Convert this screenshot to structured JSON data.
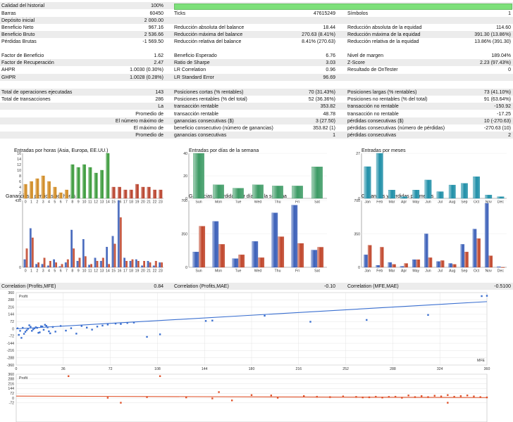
{
  "header": {
    "calidad_label": "Calidad del historial",
    "calidad_value": "100%",
    "calidad_fill": 1.0
  },
  "stats_top": [
    {
      "l1": "Barras",
      "v1": "60450",
      "l2": "Ticks",
      "v2": "47615249",
      "l3": "Símbolos",
      "v3": "1"
    },
    {
      "l1": "Depósito inicial",
      "v1": "2 000.00",
      "l2": "",
      "v2": "",
      "l3": "",
      "v3": ""
    },
    {
      "l1": "Beneficio Neto",
      "v1": "967.16",
      "l2": "Reducción absoluta del balance",
      "v2": "18.44",
      "l3": "Reducción absoluta de la equidad",
      "v3": "114.60"
    },
    {
      "l1": "Beneficio Bruto",
      "v1": "2 536.66",
      "l2": "Reducción máxima del balance",
      "v2": "270.63 (8.41%)",
      "l3": "Reducción máxima de la equidad",
      "v3": "391.30 (13.86%)"
    },
    {
      "l1": "Pérdidas Brutas",
      "v1": "-1 569.50",
      "l2": "Reducción relativa del balance",
      "v2": "8.41% (270.63)",
      "l3": "Reducción relativa de la equidad",
      "v3": "13.86% (391.30)"
    }
  ],
  "stats_mid": [
    {
      "l1": "Factor de Beneficio",
      "v1": "1.62",
      "l2": "Beneficio Esperado",
      "v2": "6.76",
      "l3": "Nivel de margen",
      "v3": "189.04%"
    },
    {
      "l1": "Factor de Recuperación",
      "v1": "2.47",
      "l2": "Ratio de Sharpe",
      "v2": "3.03",
      "l3": "Z-Score",
      "v3": "2.23 (97.43%)"
    },
    {
      "l1": "AHPR",
      "v1": "1.0030 (0.30%)",
      "l2": "LR Correlation",
      "v2": "0.96",
      "l3": "Resultado de OnTester",
      "v3": "0"
    },
    {
      "l1": "GHPR",
      "v1": "1.0028 (0.28%)",
      "l2": "LR Standard Error",
      "v2": "96.69",
      "l3": "",
      "v3": ""
    }
  ],
  "stats_trades": [
    {
      "l1": "Total de operaciones ejecutadas",
      "v1": "143",
      "l2": "Posiciones cortas (% rentables)",
      "v2": "70 (31.43%)",
      "l3": "Posiciones largas (% rentables)",
      "v3": "73 (41.10%)",
      "right": false
    },
    {
      "l1": "Total de transacciones",
      "v1": "286",
      "l2": "Posiciones rentables (% del total)",
      "v2": "52 (36.36%)",
      "l3": "Posiciones no rentables (% del total)",
      "v3": "91 (63.64%)",
      "right": false
    },
    {
      "l1": "La",
      "v1": "",
      "l2": "transacción rentable",
      "v2": "353.82",
      "l3": "transacción no rentable",
      "v3": "-150.92",
      "right": true
    },
    {
      "l1": "Promedio de",
      "v1": "",
      "l2": "transacción rentable",
      "v2": "48.78",
      "l3": "transacción no rentable",
      "v3": "-17.25",
      "right": true
    },
    {
      "l1": "El número máximo de",
      "v1": "",
      "l2": "ganancias consecutivas ($)",
      "v2": "3 (27.50)",
      "l3": "pérdidas consecutivas ($)",
      "v3": "10 (-270.63)",
      "right": true
    },
    {
      "l1": "El máximo de",
      "v1": "",
      "l2": "beneficio consecutivo (número de ganancias)",
      "v2": "353.82 (1)",
      "l3": "pérdidas consecutivas (número de pérdidas)",
      "v3": "-270.63 (10)",
      "right": true
    },
    {
      "l1": "Promedio de",
      "v1": "",
      "l2": "ganancias consecutivas",
      "v2": "1",
      "l3": "pérdidas consecutivas",
      "v3": "2",
      "right": true
    }
  ],
  "correlation": {
    "l1": "Correlation (Profits,MFE)",
    "v1": "0.84",
    "l2": "Correlation (Profits,MAE)",
    "v2": "-0.10",
    "l3": "Correlation (MFE,MAE)",
    "v3": "-0.5100"
  },
  "colors": {
    "asia": "#d08a22",
    "europe": "#3a9a3a",
    "usa": "#b8402a",
    "weekday": "#3c9a64",
    "month": "#1f8fa8",
    "profit": "#3a5fb8",
    "loss": "#c0452a",
    "scatter_mfe": "#3a6fd0",
    "scatter_mae": "#e0522a"
  },
  "charts": {
    "hours_title": "Entradas por horas (Asia, Europa, EE.UU.)",
    "weekday_title": "Entradas por días de la semana",
    "months_title": "Entradas por meses",
    "pl_hours_title": "Ganancias y pérdidas por horas",
    "pl_weekday_title": "Ganancias y pérdidas por días de la semana",
    "pl_months_title": "Ganancias y pérdidas por meses",
    "scatter1_label": "Profit",
    "scatter1_xlabel": "MFE",
    "scatter2_label": "Profit"
  },
  "chart_data": [
    {
      "type": "bar",
      "title": "Entradas por horas (Asia, Europa, EE.UU.)",
      "ylim": [
        0,
        16
      ],
      "yticks": [
        "0",
        "2",
        "4",
        "6",
        "8",
        "10",
        "12",
        "14",
        "16"
      ],
      "categories": [
        "0",
        "1",
        "2",
        "3",
        "4",
        "5",
        "6",
        "7",
        "8",
        "9",
        "10",
        "11",
        "12",
        "13",
        "14",
        "15",
        "16",
        "17",
        "18",
        "19",
        "20",
        "21",
        "22",
        "23"
      ],
      "values": [
        5,
        6,
        7,
        8,
        6,
        4,
        2,
        3,
        12,
        11,
        12,
        11,
        9,
        10,
        16,
        4,
        4,
        3,
        3,
        5,
        4,
        4,
        3,
        3
      ]
    },
    {
      "type": "bar",
      "title": "Entradas por días de la semana",
      "ylim": [
        0,
        40
      ],
      "yticks": [
        "0",
        "20",
        "40"
      ],
      "categories": [
        "Sun",
        "Mon",
        "Tue",
        "Wed",
        "Thu",
        "Fri",
        "Sat"
      ],
      "values": [
        40,
        12,
        9,
        12,
        11,
        11,
        28
      ]
    },
    {
      "type": "bar",
      "title": "Entradas por meses",
      "ylim": [
        0,
        27
      ],
      "yticks": [
        "0",
        "27"
      ],
      "categories": [
        "Jan",
        "Feb",
        "Mar",
        "Apr",
        "May",
        "Jun",
        "Jul",
        "Aug",
        "Sep",
        "Oct",
        "Nov",
        "Dec"
      ],
      "values": [
        19,
        27,
        5,
        1,
        5,
        11,
        4,
        8,
        9,
        13,
        2,
        1
      ]
    },
    {
      "type": "bar",
      "title": "Ganancias y pérdidas por horas",
      "ylim": [
        0,
        430
      ],
      "yticks": [
        "0",
        "430"
      ],
      "categories": [
        "0",
        "1",
        "2",
        "3",
        "4",
        "5",
        "6",
        "7",
        "8",
        "9",
        "10",
        "11",
        "12",
        "13",
        "14",
        "15",
        "16",
        "17",
        "18",
        "19",
        "20",
        "21",
        "22",
        "23"
      ],
      "series": [
        {
          "values": [
            50,
            250,
            20,
            20,
            10,
            50,
            5,
            30,
            240,
            40,
            180,
            15,
            60,
            40,
            130,
            200,
            430,
            60,
            40,
            50,
            10,
            40,
            10,
            30
          ]
        },
        {
          "values": [
            120,
            190,
            30,
            60,
            40,
            30,
            20,
            50,
            120,
            60,
            70,
            20,
            40,
            60,
            20,
            150,
            320,
            40,
            50,
            40,
            40,
            30,
            40,
            30
          ]
        }
      ]
    },
    {
      "type": "bar",
      "title": "Ganancias y pérdidas por días de la semana",
      "ylim": [
        0,
        700
      ],
      "yticks": [
        "0",
        "350",
        "700"
      ],
      "categories": [
        "Sun",
        "Mon",
        "Tue",
        "Wed",
        "Thu",
        "Fri",
        "Sat"
      ],
      "series": [
        {
          "values": [
            160,
            480,
            90,
            270,
            570,
            650,
            180
          ]
        },
        {
          "values": [
            430,
            240,
            130,
            100,
            320,
            250,
            210
          ]
        }
      ]
    },
    {
      "type": "bar",
      "title": "Ganancias y pérdidas por meses",
      "ylim": [
        0,
        700
      ],
      "yticks": [
        "0",
        "350",
        "700"
      ],
      "categories": [
        "Jan",
        "Feb",
        "Mar",
        "Apr",
        "May",
        "Jun",
        "Jul",
        "Aug",
        "Sep",
        "Oct",
        "Nov",
        "Dec"
      ],
      "series": [
        {
          "values": [
            130,
            20,
            50,
            10,
            80,
            350,
            60,
            40,
            240,
            400,
            670,
            5
          ]
        },
        {
          "values": [
            230,
            210,
            30,
            40,
            80,
            100,
            70,
            30,
            160,
            300,
            120,
            0
          ]
        }
      ]
    },
    {
      "type": "scatter",
      "title": "",
      "ylabel": "Profit",
      "xlabel": "MFE",
      "xlim": [
        0,
        360
      ],
      "ylim": [
        -360,
        360
      ],
      "xticks": [
        "0",
        "36",
        "72",
        "108",
        "144",
        "180",
        "216",
        "252",
        "288",
        "324",
        "360"
      ],
      "yticks": [
        "360",
        "288",
        "216",
        "144",
        "72",
        "0",
        "-72",
        "-144",
        "-216",
        "-288",
        "-360"
      ],
      "points": [
        [
          1,
          5
        ],
        [
          3,
          -20
        ],
        [
          5,
          10
        ],
        [
          7,
          -30
        ],
        [
          9,
          0
        ],
        [
          11,
          20
        ],
        [
          13,
          -5
        ],
        [
          15,
          15
        ],
        [
          17,
          -40
        ],
        [
          19,
          25
        ],
        [
          21,
          -10
        ],
        [
          23,
          30
        ],
        [
          25,
          -25
        ],
        [
          2,
          -60
        ],
        [
          4,
          -90
        ],
        [
          6,
          -50
        ],
        [
          8,
          -15
        ],
        [
          10,
          35
        ],
        [
          12,
          -20
        ],
        [
          14,
          5
        ],
        [
          16,
          10
        ],
        [
          18,
          -35
        ],
        [
          20,
          22
        ],
        [
          22,
          40
        ],
        [
          24,
          15
        ],
        [
          26,
          -45
        ],
        [
          28,
          18
        ],
        [
          30,
          -28
        ],
        [
          34,
          28
        ],
        [
          38,
          -18
        ],
        [
          42,
          6
        ],
        [
          46,
          -48
        ],
        [
          50,
          28
        ],
        [
          54,
          12
        ],
        [
          58,
          -8
        ],
        [
          62,
          22
        ],
        [
          66,
          32
        ],
        [
          70,
          42
        ],
        [
          76,
          52
        ],
        [
          80,
          48
        ],
        [
          85,
          58
        ],
        [
          90,
          62
        ],
        [
          100,
          -80
        ],
        [
          110,
          -55
        ],
        [
          145,
          78
        ],
        [
          150,
          82
        ],
        [
          190,
          130
        ],
        [
          225,
          70
        ],
        [
          268,
          88
        ],
        [
          315,
          138
        ],
        [
          356,
          325
        ],
        [
          360,
          328
        ]
      ],
      "trend": [
        [
          0,
          0
        ],
        [
          360,
          270
        ]
      ]
    },
    {
      "type": "scatter",
      "title": "",
      "ylabel": "Profit",
      "xlim": [
        0,
        360
      ],
      "ylim": [
        -360,
        360
      ],
      "yticks": [
        "360",
        "288",
        "216",
        "144",
        "72",
        "0",
        "-72"
      ],
      "points": [
        [
          40,
          330
        ],
        [
          110,
          330
        ],
        [
          155,
          90
        ],
        [
          195,
          40
        ],
        [
          230,
          20
        ],
        [
          290,
          20
        ],
        [
          305,
          15
        ],
        [
          330,
          -70
        ],
        [
          165,
          -35
        ],
        [
          80,
          -70
        ],
        [
          335,
          20
        ],
        [
          340,
          30
        ],
        [
          345,
          40
        ],
        [
          350,
          25
        ],
        [
          355,
          15
        ],
        [
          360,
          10
        ],
        [
          320,
          35
        ],
        [
          325,
          25
        ],
        [
          330,
          45
        ],
        [
          300,
          40
        ],
        [
          310,
          30
        ],
        [
          315,
          15
        ],
        [
          270,
          12
        ],
        [
          275,
          20
        ],
        [
          280,
          8
        ],
        [
          285,
          18
        ],
        [
          295,
          5
        ],
        [
          250,
          25
        ],
        [
          260,
          18
        ],
        [
          265,
          10
        ],
        [
          220,
          30
        ],
        [
          240,
          15
        ],
        [
          180,
          45
        ],
        [
          200,
          5
        ],
        [
          150,
          -5
        ],
        [
          130,
          10
        ],
        [
          100,
          15
        ],
        [
          70,
          5
        ]
      ],
      "trend": [
        [
          0,
          30
        ],
        [
          360,
          8
        ]
      ]
    }
  ]
}
